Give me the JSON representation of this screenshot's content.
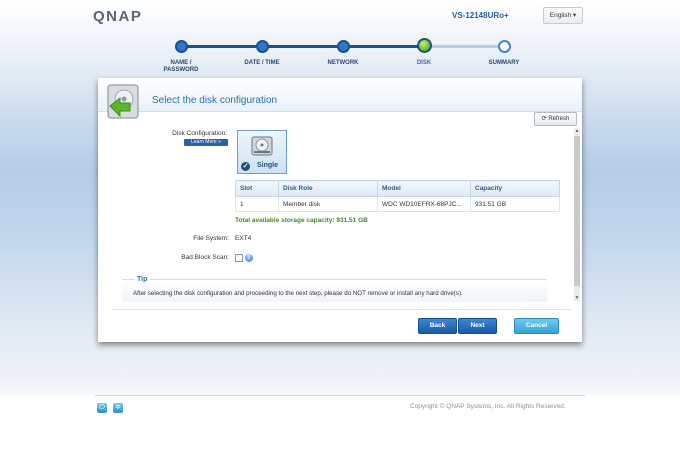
{
  "header": {
    "logo": "QNAP",
    "model": "VS-12148URo+",
    "language": "English ▾"
  },
  "wizard": {
    "steps": [
      {
        "label_line1": "NAME /",
        "label_line2": "PASSWORD",
        "state": "done"
      },
      {
        "label_line1": "DATE / TIME",
        "label_line2": "",
        "state": "done"
      },
      {
        "label_line1": "NETWORK",
        "label_line2": "",
        "state": "done"
      },
      {
        "label_line1": "DISK",
        "label_line2": "",
        "state": "current"
      },
      {
        "label_line1": "SUMMARY",
        "label_line2": "",
        "state": "future"
      }
    ]
  },
  "dialog": {
    "title": "Select the disk configuration",
    "refresh_label": "Refresh",
    "disk_config_label": "Disk Configuration:",
    "learn_more_label": "Learn More »",
    "disk_option_label": "Single",
    "table": {
      "headers": [
        "Slot",
        "Disk Role",
        "Model",
        "Capacity"
      ],
      "rows": [
        [
          "1",
          "Member disk",
          "WDC WD10EFRX-68PJC...",
          "931.51 GB"
        ]
      ]
    },
    "capacity_text": "Total available storage capacity: 931.51 GB",
    "file_system_label": "File System:",
    "file_system_value": "EXT4",
    "bad_block_label": "Bad Block Scan:",
    "tip_title": "Tip",
    "tip_text": "After selecting the disk configuration and proceeding to the next step, please do NOT remove or install any hard drive(s).",
    "back_label": "Back",
    "next_label": "Next",
    "cancel_label": "Cancel"
  },
  "footer": {
    "copyright": "Copyright © QNAP Systems, Inc. All Rights Reserved."
  },
  "colors": {
    "accent": "#2a6fb3",
    "progress_dark": "#1d4f8e",
    "current_step": "#5bb52a",
    "capacity_green": "#3f8b1c"
  }
}
